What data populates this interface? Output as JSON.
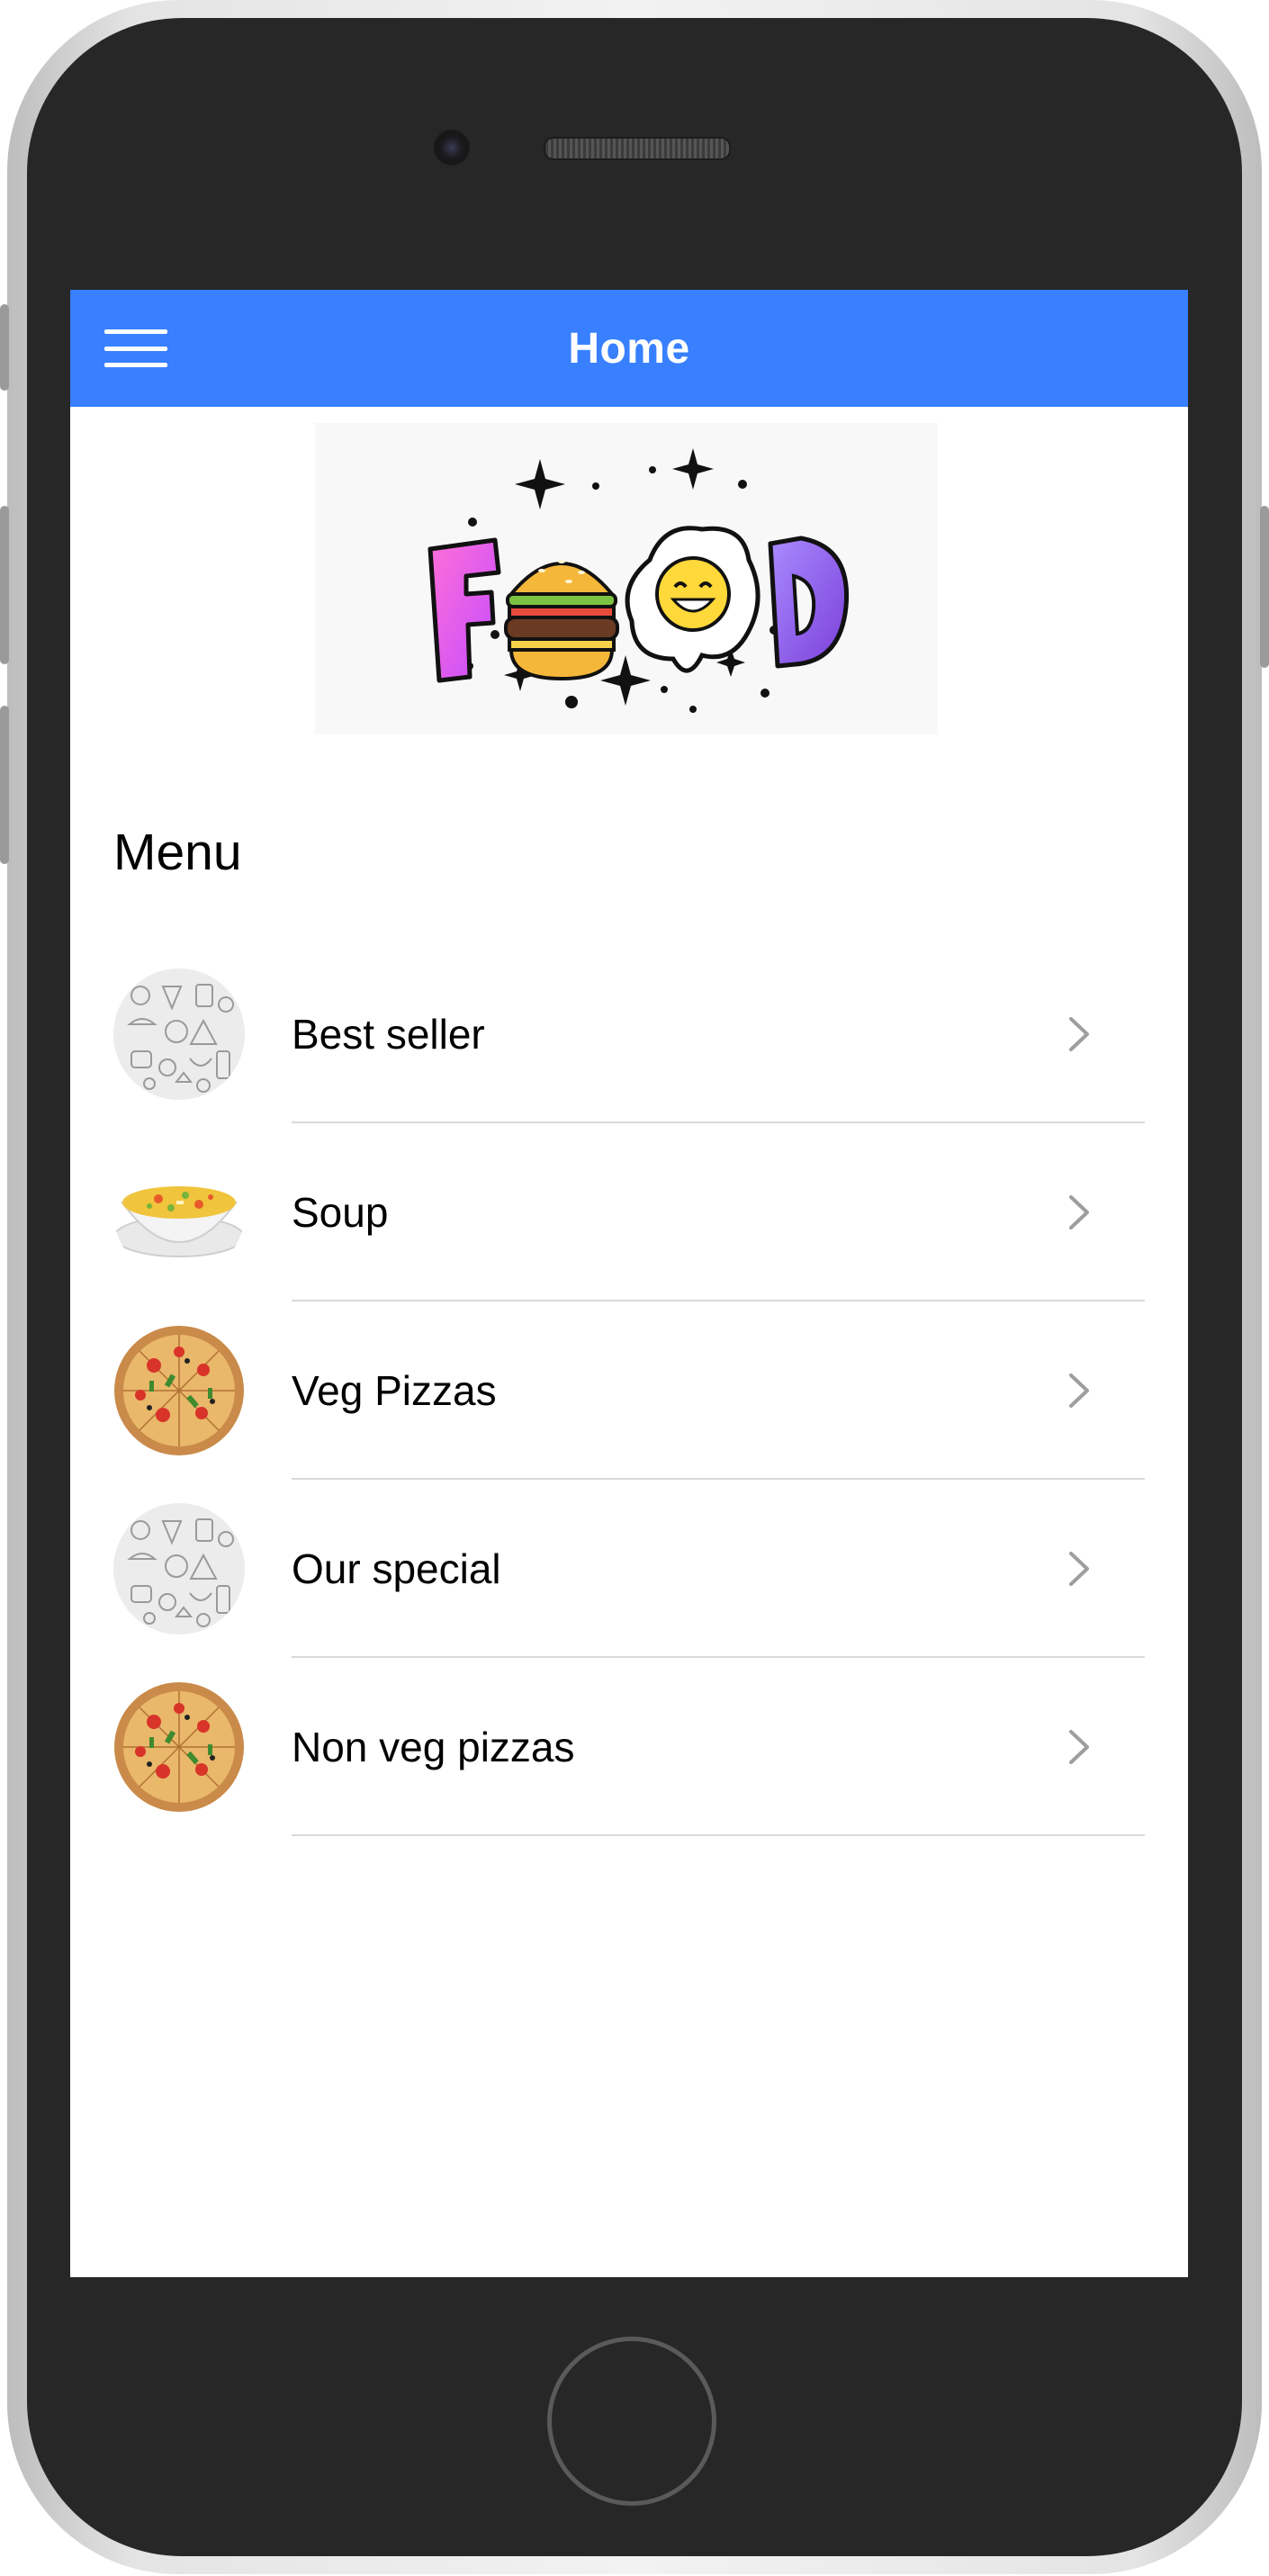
{
  "app": {
    "title": "Home"
  },
  "logo": {
    "text": "FOOD"
  },
  "menu": {
    "heading": "Menu",
    "items": [
      {
        "label": "Best seller",
        "thumb": "doodle-pattern-icon"
      },
      {
        "label": "Soup",
        "thumb": "soup-bowl-icon"
      },
      {
        "label": "Veg Pizzas",
        "thumb": "pizza-icon"
      },
      {
        "label": "Our special",
        "thumb": "doodle-pattern-icon"
      },
      {
        "label": "Non veg pizzas",
        "thumb": "pizza-icon"
      }
    ]
  },
  "colors": {
    "primary": "#3880ff",
    "divider": "#d9d9d9",
    "chevron": "#9e9e9e"
  }
}
